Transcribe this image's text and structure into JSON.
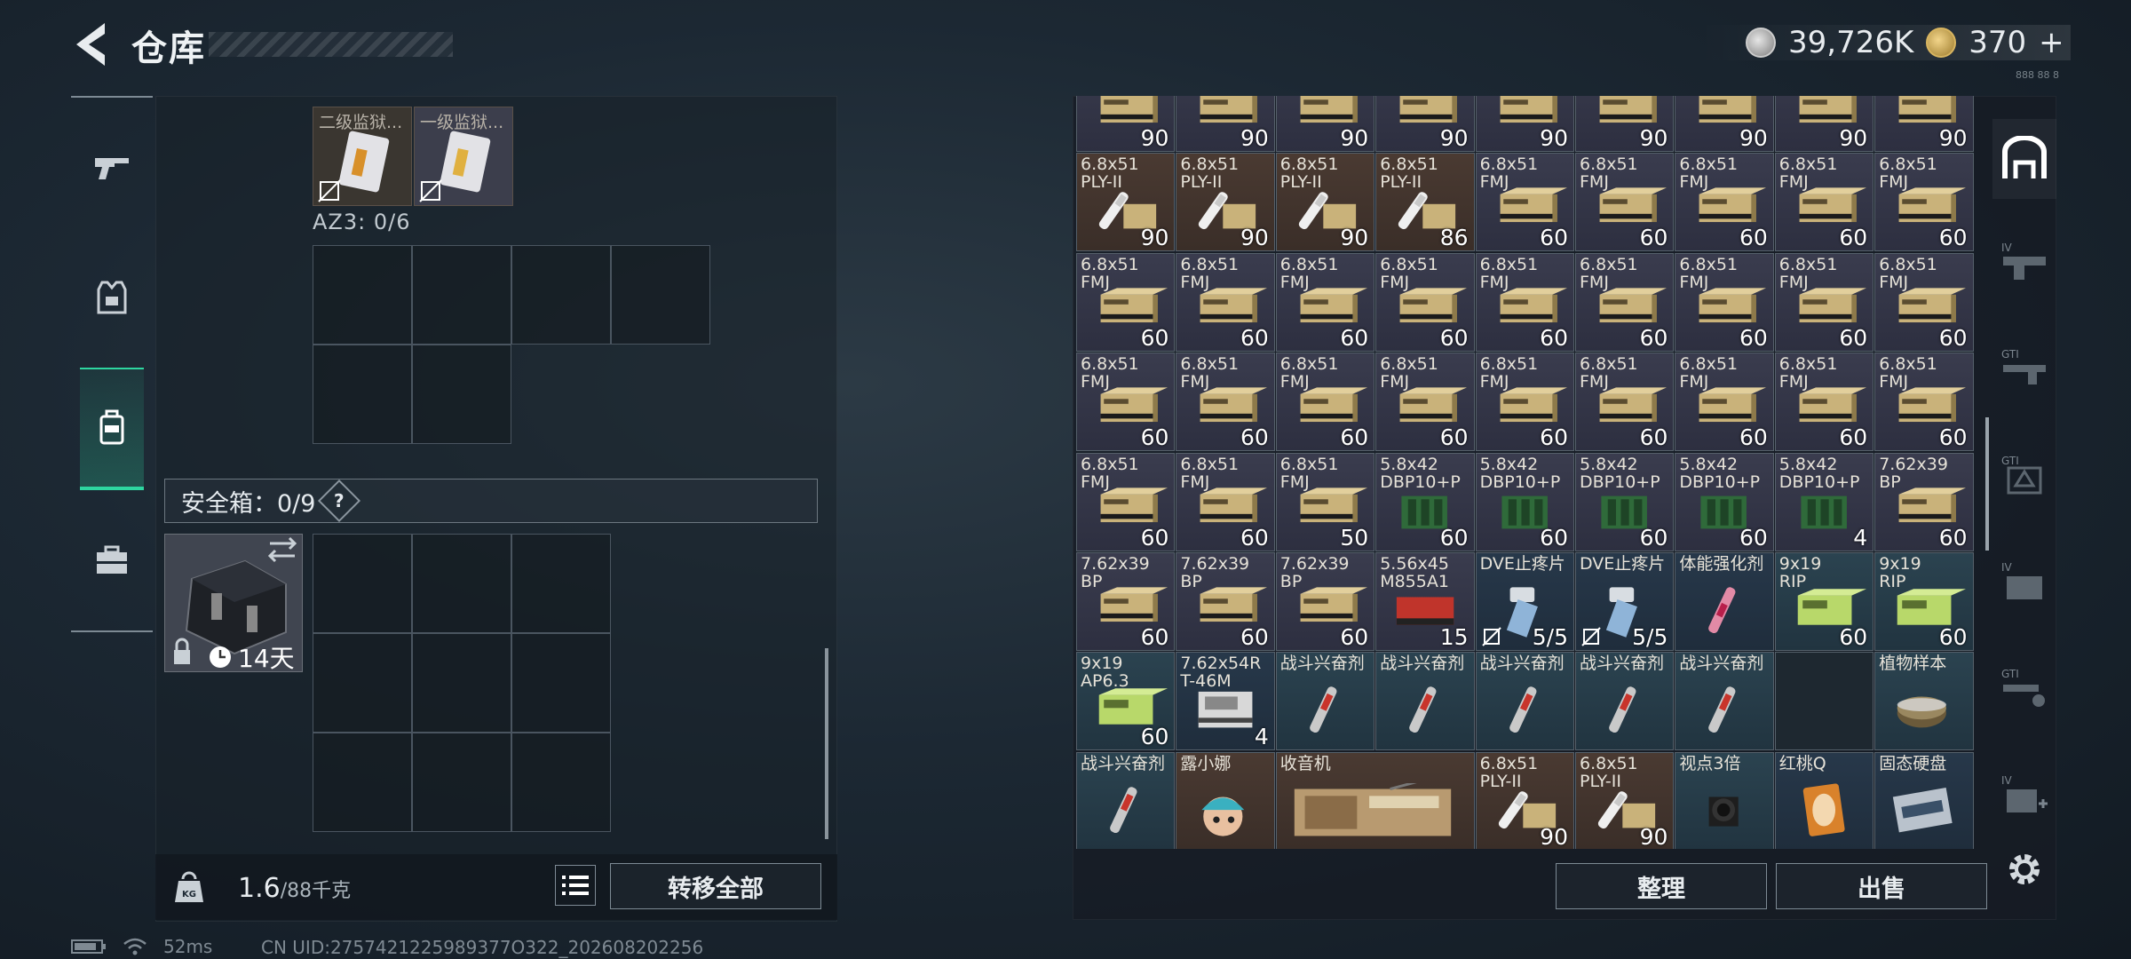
{
  "header": {
    "title": "仓库",
    "silver_amount": "39,726K",
    "gold_amount": "370",
    "gold_plus": "+",
    "tiny_text": "888 88 8"
  },
  "left_nav": {
    "items": [
      "gun-icon",
      "armor-vest-icon",
      "backpack-icon",
      "briefcase-icon"
    ],
    "active": "backpack-icon"
  },
  "left_panel": {
    "top_items": [
      {
        "name": "二级监狱...",
        "locked": true
      },
      {
        "name": "一级监狱...",
        "locked": true
      }
    ],
    "az3_label": "AZ3: 0/6",
    "safe_label": "安全箱：0/9",
    "safe_help": "?",
    "safebox_timer": "14天",
    "weight_current": "1.6",
    "weight_max": "/88千克",
    "weight_icon_text": "KG",
    "transfer_all": "转移全部"
  },
  "status": {
    "ping": "52ms",
    "uid": "CN UID:2757421225989377O322_202608202256"
  },
  "inventory": {
    "colors": {
      "gold": "#c9b27a",
      "green": "#2f6a3a",
      "red": "#c0342b"
    },
    "rows": [
      [
        {
          "n": "",
          "c": "90",
          "t": "ammo_gold"
        },
        {
          "n": "",
          "c": "90",
          "t": "ammo_gold"
        },
        {
          "n": "",
          "c": "90",
          "t": "ammo_gold"
        },
        {
          "n": "",
          "c": "90",
          "t": "ammo_gold"
        },
        {
          "n": "",
          "c": "90",
          "t": "ammo_gold"
        },
        {
          "n": "",
          "c": "90",
          "t": "ammo_gold"
        },
        {
          "n": "",
          "c": "90",
          "t": "ammo_gold"
        },
        {
          "n": "",
          "c": "90",
          "t": "ammo_gold"
        },
        {
          "n": "",
          "c": "90",
          "t": "ammo_gold"
        }
      ],
      [
        {
          "n": "6.8x51\nPLY-II",
          "c": "90",
          "t": "bullet_white"
        },
        {
          "n": "6.8x51\nPLY-II",
          "c": "90",
          "t": "bullet_white"
        },
        {
          "n": "6.8x51\nPLY-II",
          "c": "90",
          "t": "bullet_white"
        },
        {
          "n": "6.8x51\nPLY-II",
          "c": "86",
          "t": "bullet_white"
        },
        {
          "n": "6.8x51\nFMJ",
          "c": "60",
          "t": "ammo_gold"
        },
        {
          "n": "6.8x51\nFMJ",
          "c": "60",
          "t": "ammo_gold"
        },
        {
          "n": "6.8x51\nFMJ",
          "c": "60",
          "t": "ammo_gold"
        },
        {
          "n": "6.8x51\nFMJ",
          "c": "60",
          "t": "ammo_gold"
        },
        {
          "n": "6.8x51\nFMJ",
          "c": "60",
          "t": "ammo_gold"
        }
      ],
      [
        {
          "n": "6.8x51\nFMJ",
          "c": "60",
          "t": "ammo_gold"
        },
        {
          "n": "6.8x51\nFMJ",
          "c": "60",
          "t": "ammo_gold"
        },
        {
          "n": "6.8x51\nFMJ",
          "c": "60",
          "t": "ammo_gold"
        },
        {
          "n": "6.8x51\nFMJ",
          "c": "60",
          "t": "ammo_gold"
        },
        {
          "n": "6.8x51\nFMJ",
          "c": "60",
          "t": "ammo_gold"
        },
        {
          "n": "6.8x51\nFMJ",
          "c": "60",
          "t": "ammo_gold"
        },
        {
          "n": "6.8x51\nFMJ",
          "c": "60",
          "t": "ammo_gold"
        },
        {
          "n": "6.8x51\nFMJ",
          "c": "60",
          "t": "ammo_gold"
        },
        {
          "n": "6.8x51\nFMJ",
          "c": "60",
          "t": "ammo_gold"
        }
      ],
      [
        {
          "n": "6.8x51\nFMJ",
          "c": "60",
          "t": "ammo_gold"
        },
        {
          "n": "6.8x51\nFMJ",
          "c": "60",
          "t": "ammo_gold"
        },
        {
          "n": "6.8x51\nFMJ",
          "c": "60",
          "t": "ammo_gold"
        },
        {
          "n": "6.8x51\nFMJ",
          "c": "60",
          "t": "ammo_gold"
        },
        {
          "n": "6.8x51\nFMJ",
          "c": "60",
          "t": "ammo_gold"
        },
        {
          "n": "6.8x51\nFMJ",
          "c": "60",
          "t": "ammo_gold"
        },
        {
          "n": "6.8x51\nFMJ",
          "c": "60",
          "t": "ammo_gold"
        },
        {
          "n": "6.8x51\nFMJ",
          "c": "60",
          "t": "ammo_gold"
        },
        {
          "n": "6.8x51\nFMJ",
          "c": "60",
          "t": "ammo_gold"
        }
      ],
      [
        {
          "n": "6.8x51\nFMJ",
          "c": "60",
          "t": "ammo_gold"
        },
        {
          "n": "6.8x51\nFMJ",
          "c": "60",
          "t": "ammo_gold"
        },
        {
          "n": "6.8x51\nFMJ",
          "c": "50",
          "t": "ammo_gold"
        },
        {
          "n": "5.8x42\nDBP10+P",
          "c": "60",
          "t": "ammo_green"
        },
        {
          "n": "5.8x42\nDBP10+P",
          "c": "60",
          "t": "ammo_green"
        },
        {
          "n": "5.8x42\nDBP10+P",
          "c": "60",
          "t": "ammo_green"
        },
        {
          "n": "5.8x42\nDBP10+P",
          "c": "60",
          "t": "ammo_green"
        },
        {
          "n": "5.8x42\nDBP10+P",
          "c": "4",
          "t": "ammo_green"
        },
        {
          "n": "7.62x39\nBP",
          "c": "60",
          "t": "ammo_gold"
        }
      ],
      [
        {
          "n": "7.62x39\nBP",
          "c": "60",
          "t": "ammo_gold"
        },
        {
          "n": "7.62x39\nBP",
          "c": "60",
          "t": "ammo_gold"
        },
        {
          "n": "7.62x39\nBP",
          "c": "60",
          "t": "ammo_gold"
        },
        {
          "n": "5.56x45\nM855A1",
          "c": "15",
          "t": "ammo_red"
        },
        {
          "n": "DVE止疼片",
          "c": "5/5",
          "t": "pill",
          "lock": true
        },
        {
          "n": "DVE止疼片",
          "c": "5/5",
          "t": "pill",
          "lock": true
        },
        {
          "n": "体能强化剂",
          "c": "",
          "t": "injector_pink"
        },
        {
          "n": "9x19\nRIP",
          "c": "60",
          "t": "ammo_lime"
        },
        {
          "n": "9x19\nRIP",
          "c": "60",
          "t": "ammo_lime"
        }
      ],
      [
        {
          "n": "9x19\nAP6.3",
          "c": "60",
          "t": "ammo_lime"
        },
        {
          "n": "7.62x54R\nT-46M",
          "c": "4",
          "t": "ammo_white"
        },
        {
          "n": "战斗兴奋剂",
          "c": "",
          "t": "injector_red"
        },
        {
          "n": "战斗兴奋剂",
          "c": "",
          "t": "injector_red"
        },
        {
          "n": "战斗兴奋剂",
          "c": "",
          "t": "injector_red"
        },
        {
          "n": "战斗兴奋剂",
          "c": "",
          "t": "injector_red"
        },
        {
          "n": "战斗兴奋剂",
          "c": "",
          "t": "injector_red"
        },
        {
          "n": "",
          "c": "",
          "t": "empty"
        },
        {
          "n": "植物样本",
          "c": "",
          "t": "petri"
        }
      ],
      [
        {
          "n": "战斗兴奋剂",
          "c": "",
          "t": "injector_red"
        },
        {
          "n": "露小娜",
          "c": "",
          "t": "doll"
        },
        {
          "n": "收音机",
          "c": "",
          "t": "radio",
          "w": 2
        },
        {
          "n": "6.8x51\nPLY-II",
          "c": "90",
          "t": "bullet_white"
        },
        {
          "n": "6.8x51\nPLY-II",
          "c": "90",
          "t": "bullet_white"
        },
        {
          "n": "视点3倍",
          "c": "",
          "t": "scope"
        },
        {
          "n": "红桃Q",
          "c": "",
          "t": "card"
        },
        {
          "n": "固态硬盘",
          "c": "",
          "t": "ssd"
        }
      ]
    ]
  },
  "right_bottom": {
    "sort": "整理",
    "sell": "出售"
  }
}
